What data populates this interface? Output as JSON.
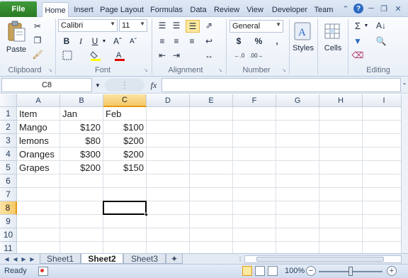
{
  "ribbon_tabs": {
    "file": "File",
    "home": "Home",
    "insert": "Insert",
    "page_layout": "Page Layout",
    "formulas": "Formulas",
    "data": "Data",
    "review": "Review",
    "view": "View",
    "developer": "Developer",
    "team": "Team"
  },
  "ribbon": {
    "clipboard": {
      "paste_label": "Paste",
      "group_label": "Clipboard"
    },
    "font": {
      "font_name": "Calibri",
      "font_size": "11",
      "group_label": "Font"
    },
    "alignment": {
      "group_label": "Alignment"
    },
    "number": {
      "format": "General",
      "group_label": "Number",
      "currency_symbol": "$",
      "percent_symbol": "%",
      "comma_symbol": ","
    },
    "styles": {
      "label": "Styles"
    },
    "cells": {
      "label": "Cells"
    },
    "editing": {
      "group_label": "Editing",
      "sum_symbol": "Σ"
    }
  },
  "formula_bar": {
    "name_box": "C8",
    "fx_label": "fx",
    "content": ""
  },
  "grid": {
    "column_headers": [
      "A",
      "B",
      "C",
      "D",
      "E",
      "F",
      "G",
      "H",
      "I"
    ],
    "row_headers": [
      "1",
      "2",
      "3",
      "4",
      "5",
      "6",
      "7",
      "8",
      "9",
      "10",
      "11"
    ],
    "selected_cell": "C8",
    "rows": [
      [
        "Item",
        "Jan",
        "Feb"
      ],
      [
        "Mango",
        "$120",
        "$100"
      ],
      [
        "lemons",
        "$80",
        "$200"
      ],
      [
        "Oranges",
        "$300",
        "$200"
      ],
      [
        "Grapes",
        "$200",
        "$150"
      ]
    ]
  },
  "sheet_tabs": [
    "Sheet1",
    "Sheet2",
    "Sheet3"
  ],
  "active_sheet": "Sheet2",
  "status_bar": {
    "mode": "Ready",
    "zoom": "100%"
  },
  "colors": {
    "file_tab": "#2a7a25",
    "selection_header": "#f5c966",
    "accent": "#2c6bc2"
  }
}
